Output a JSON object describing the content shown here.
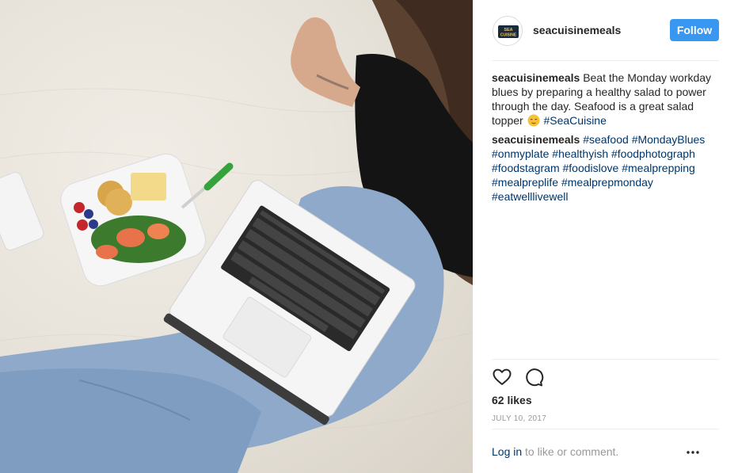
{
  "post": {
    "photo_description_icon": "food-laptop-photo",
    "author": {
      "username": "seacuisinemeals",
      "avatar_text_top": "SEA",
      "avatar_text_bottom": "CUISINE"
    },
    "follow_label": "Follow",
    "caption": {
      "username": "seacuisinemeals",
      "text": "Beat the Monday workday blues by preparing a healthy salad to power through the day. Seafood is a great salad topper",
      "emoji_icon": "relieved-face-emoji",
      "hashtag": "#SeaCuisine"
    },
    "comment": {
      "username": "seacuisinemeals",
      "hashtags": [
        "#seafood",
        "#MondayBlues",
        "#onmyplate",
        "#healthyish",
        "#foodphotograph",
        "#foodstagram",
        "#foodislove",
        "#mealprepping",
        "#mealpreplife",
        "#mealprepmonday",
        "#eatwelllivewell"
      ]
    },
    "likes": "62 likes",
    "date": "JULY 10, 2017",
    "login_link": "Log in",
    "login_suffix": " to like or comment.",
    "icons": {
      "like": "heart-icon",
      "comment": "comment-icon",
      "more": "more-options-icon"
    },
    "colors": {
      "follow_button": "#3897f0",
      "hashtag": "#003569",
      "muted_text": "#999999",
      "divider": "#efefef"
    }
  }
}
